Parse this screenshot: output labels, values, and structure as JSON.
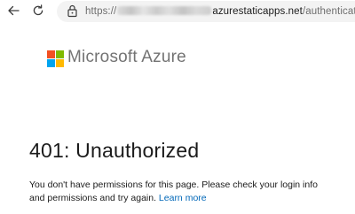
{
  "browser": {
    "url": {
      "scheme": "https://",
      "host": "azurestaticapps.net",
      "path": "/authenticated/"
    },
    "icons": {
      "back": "back-arrow-icon",
      "reload": "reload-icon",
      "lock": "lock-icon"
    }
  },
  "brand": {
    "logo_text": "Microsoft Azure",
    "colors": {
      "red": "#f25022",
      "green": "#7fba00",
      "blue": "#00a4ef",
      "yellow": "#ffb900",
      "text": "#737373"
    }
  },
  "error": {
    "title": "401: Unauthorized",
    "message": "You don't have permissions for this page. Please check your login info and permissions and try again.",
    "link_label": "Learn more",
    "link_color": "#0067b8"
  }
}
